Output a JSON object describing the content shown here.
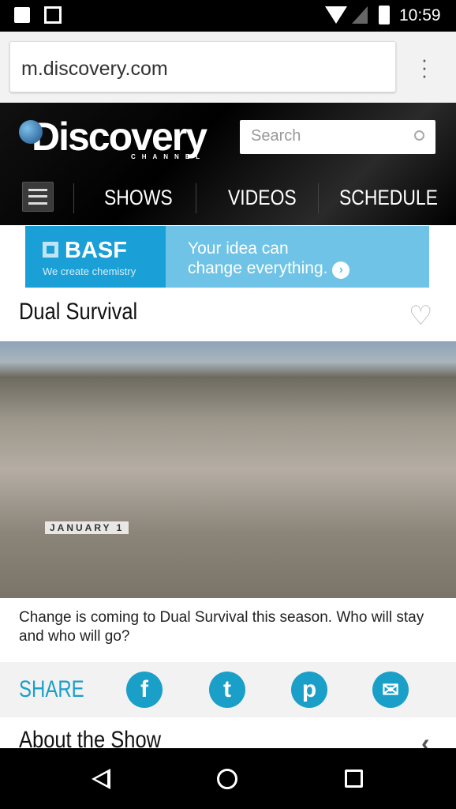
{
  "status_bar": {
    "time": "10:59",
    "icons": [
      "clipboard-check-icon",
      "app-icon",
      "wifi-icon",
      "signal-icon",
      "battery-charging-icon"
    ]
  },
  "browser": {
    "url": "m.discovery.com",
    "menu_icon": "more-vert-icon"
  },
  "header": {
    "logo_text": "Discovery",
    "logo_sub": "CHANNEL",
    "search_placeholder": "Search",
    "nav": [
      "SHOWS",
      "VIDEOS",
      "SCHEDULE"
    ]
  },
  "ad": {
    "brand": "BASF",
    "tagline": "We create chemistry",
    "message_line1": "Your idea can",
    "message_line2": "change everything.",
    "colors": {
      "left": "#1a9fd6",
      "right": "#6ec3e6"
    }
  },
  "show": {
    "title": "Dual Survival",
    "hero_overlay": "JANUARY 1",
    "caption": "Change is coming to Dual Survival this season. Who will stay and who will go?"
  },
  "share": {
    "label": "SHARE",
    "networks": [
      "facebook",
      "twitter",
      "pinterest",
      "email"
    ],
    "accent": "#1a9fc8"
  },
  "about": {
    "title": "About the Show"
  }
}
